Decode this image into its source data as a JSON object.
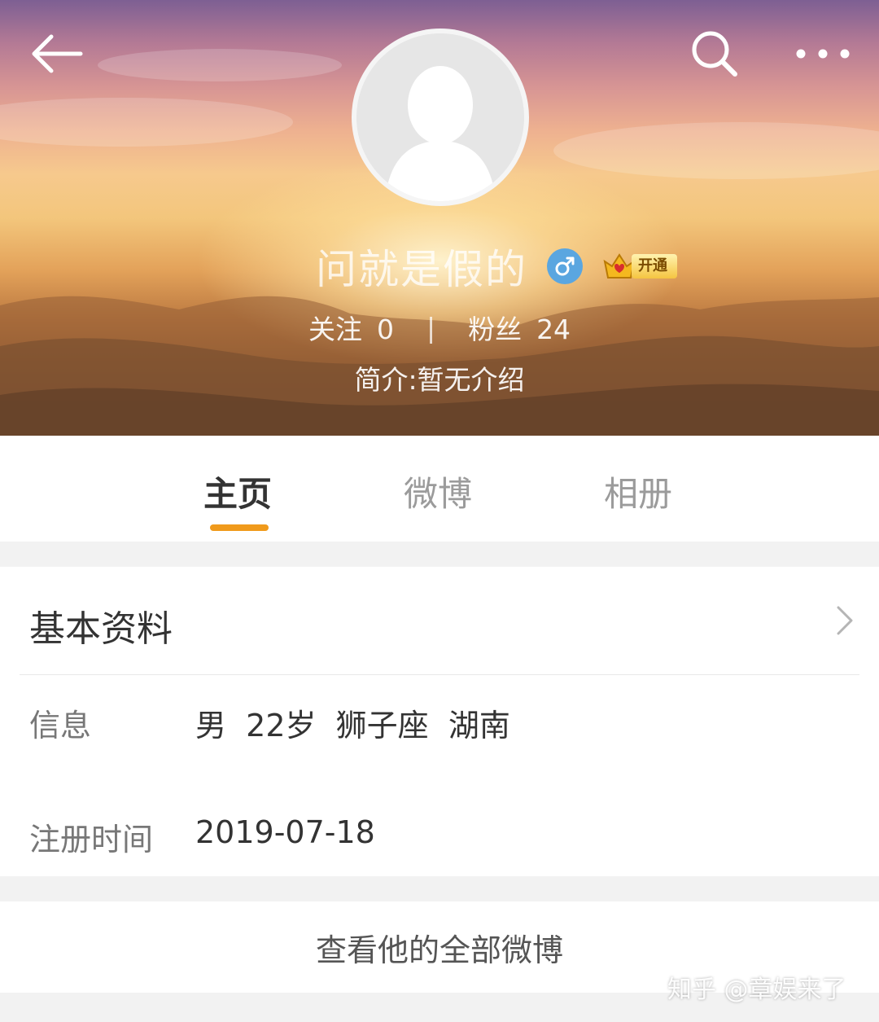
{
  "header": {
    "back_icon": "back-arrow-icon",
    "search_icon": "search-icon",
    "more_icon": "more-dots-icon",
    "avatar_icon": "default-avatar-icon",
    "name": "问就是假的",
    "gender_icon": "male-icon",
    "vip_label": "开通",
    "following_label": "关注",
    "following_count": "0",
    "separator": "|",
    "followers_label": "粉丝",
    "followers_count": "24",
    "bio": "简介:暂无介绍"
  },
  "tabs": [
    {
      "label": "主页",
      "active": true
    },
    {
      "label": "微博",
      "active": false
    },
    {
      "label": "相册",
      "active": false
    }
  ],
  "info": {
    "title": "基本资料",
    "rows": [
      {
        "label": "信息",
        "value": "男  22岁  狮子座  湖南"
      },
      {
        "label": "注册时间",
        "value": "2019-07-18"
      }
    ]
  },
  "view_all": "查看他的全部微博",
  "watermark": "知乎 @章娱来了",
  "colors": {
    "accent": "#f09a1b",
    "gender_badge": "#5aa6e0",
    "background": "#f2f2f2"
  }
}
